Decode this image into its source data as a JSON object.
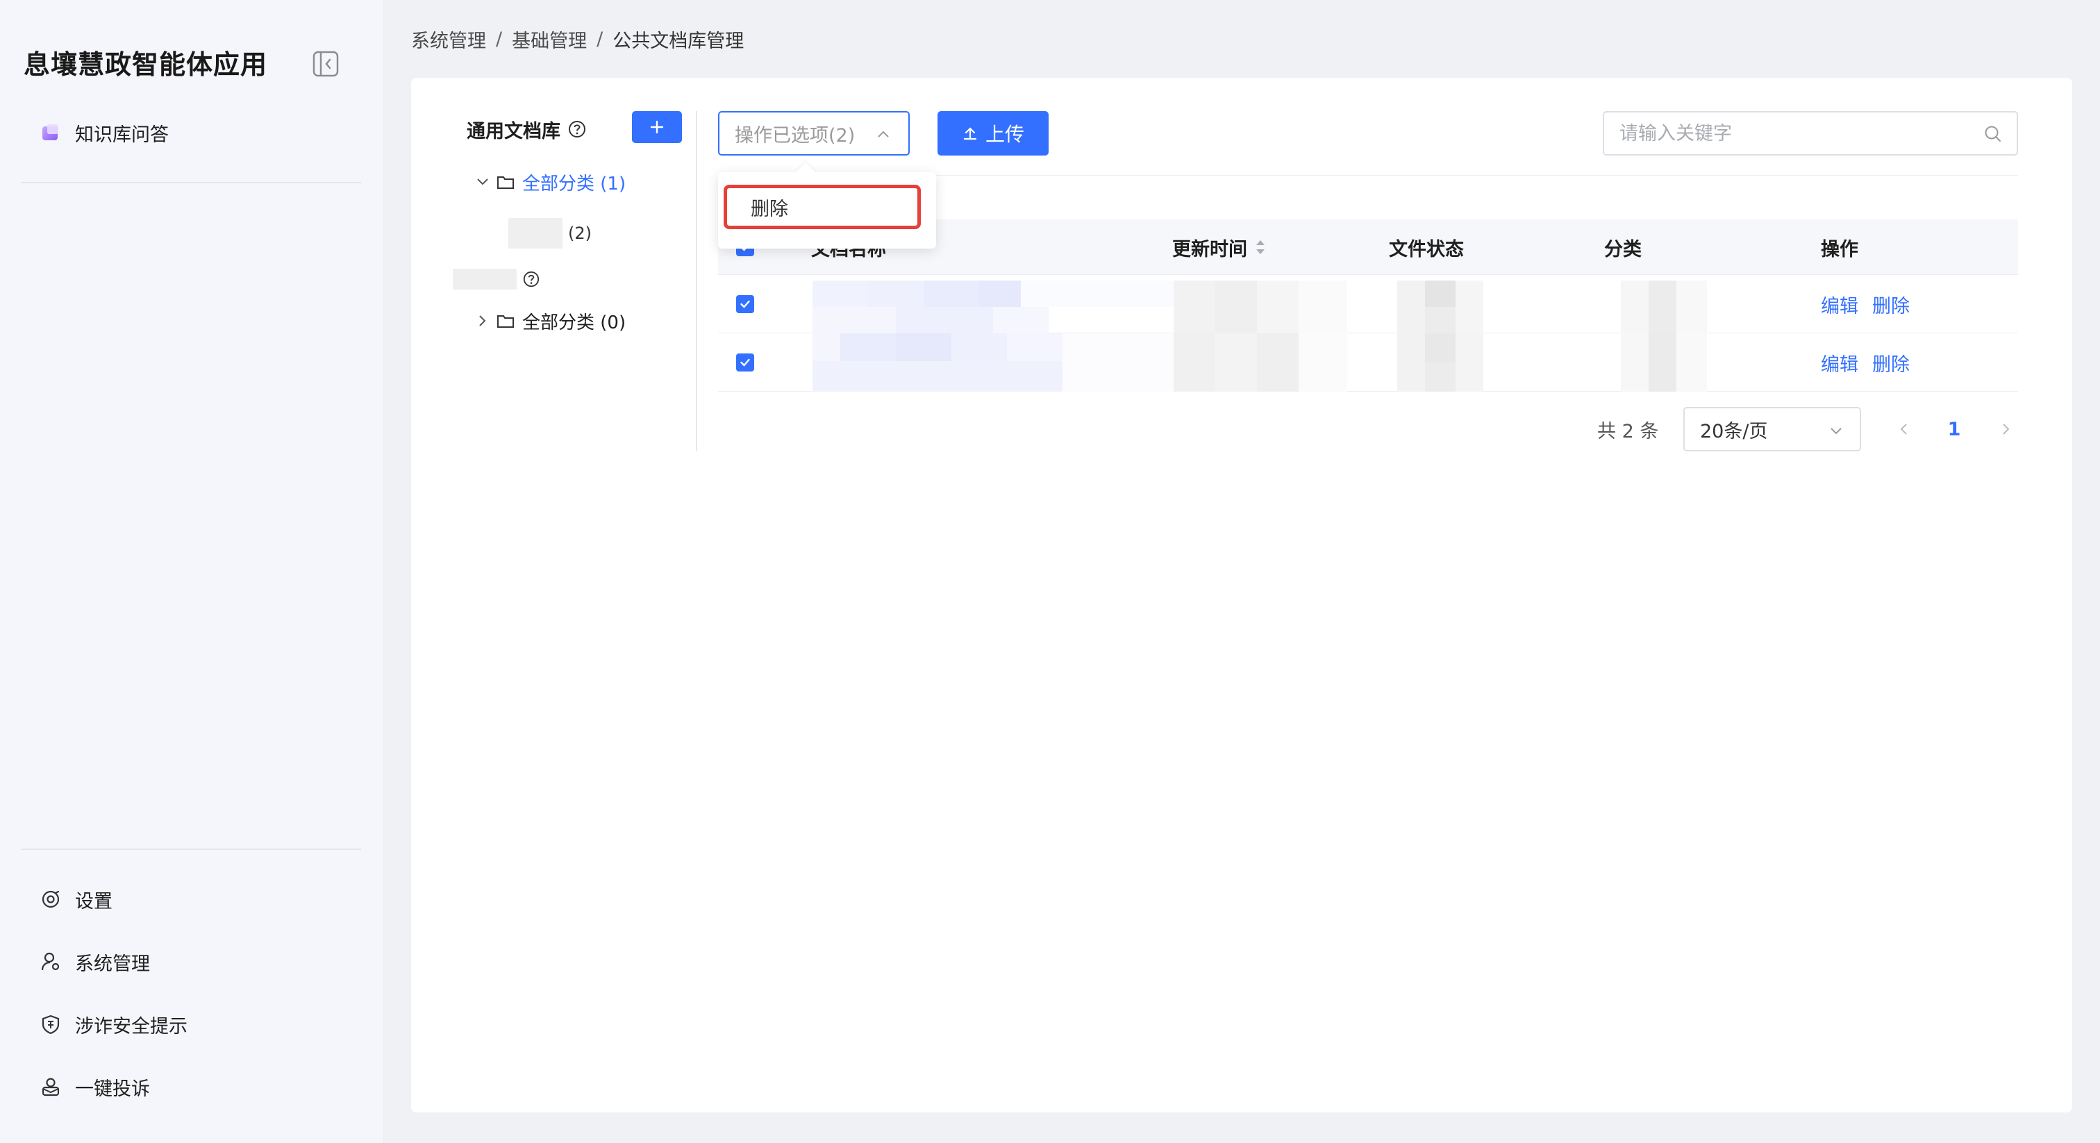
{
  "sidebar": {
    "app_title": "息壤慧政智能体应用",
    "top_items": [
      {
        "label": "知识库问答",
        "icon": "knowledge-qa-icon"
      }
    ],
    "bottom_items": [
      {
        "label": "设置",
        "icon": "settings-icon"
      },
      {
        "label": "系统管理",
        "icon": "user-settings-icon"
      },
      {
        "label": "涉诈安全提示",
        "icon": "shield-icon"
      },
      {
        "label": "一键投诉",
        "icon": "complaint-icon"
      }
    ]
  },
  "breadcrumb": [
    "系统管理",
    "基础管理",
    "公共文档库管理"
  ],
  "tree": {
    "library_title": "通用文档库",
    "add_label": "+",
    "nodes": [
      {
        "label": "全部分类 (1)",
        "expanded": true,
        "active": true
      },
      {
        "count": "(2)"
      },
      {
        "label": "全部分类 (0)",
        "expanded": false,
        "active": false
      }
    ]
  },
  "toolbar": {
    "ops_select_label": "操作已选项(2)",
    "upload_label": "上传",
    "search_placeholder": "请输入关键字"
  },
  "dropdown": {
    "items": [
      "删除"
    ]
  },
  "table": {
    "columns": [
      "文档名称",
      "更新时间",
      "文件状态",
      "分类",
      "操作"
    ],
    "rows": [
      {
        "checked": true,
        "actions": [
          "编辑",
          "删除"
        ]
      },
      {
        "checked": true,
        "actions": [
          "编辑",
          "删除"
        ]
      }
    ]
  },
  "pagination": {
    "total_text": "共 2 条",
    "page_size": "20条/页",
    "current_page": "1"
  },
  "colors": {
    "primary": "#3370ff",
    "highlight_border": "#e5413a"
  }
}
